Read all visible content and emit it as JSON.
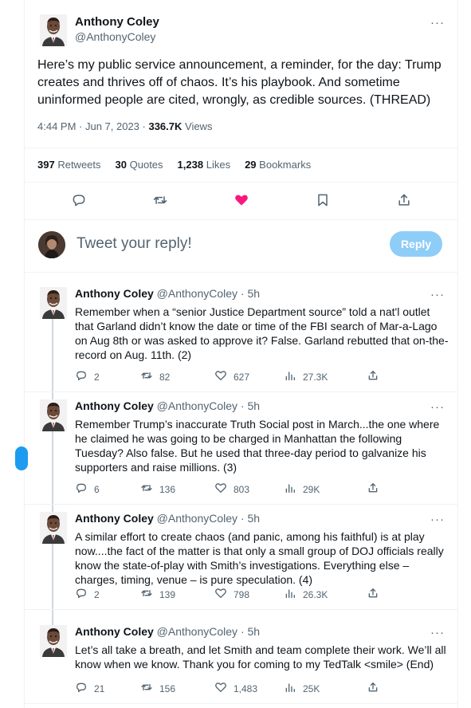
{
  "main_tweet": {
    "author_name": "Anthony Coley",
    "author_handle": "@AnthonyColey",
    "text": "Here’s my public service announcement, a reminder, for the day:  Trump creates and thrives off of chaos. It’s his playbook. And sometime uninformed people are cited, wrongly, as credible sources. (THREAD)",
    "time": "4:44 PM · Jun 7, 2023 · ",
    "views_count": "336.7K",
    "views_label": " Views",
    "stats": {
      "retweets_count": "397",
      "retweets_label": "Retweets",
      "quotes_count": "30",
      "quotes_label": "Quotes",
      "likes_count": "1,238",
      "likes_label": "Likes",
      "bookmarks_count": "29",
      "bookmarks_label": "Bookmarks"
    },
    "actions": [
      "reply",
      "retweet",
      "like",
      "bookmark",
      "share"
    ],
    "liked": true
  },
  "reply_box": {
    "placeholder": "Tweet your reply!",
    "button_label": "Reply"
  },
  "more_glyph": "···",
  "replies": [
    {
      "name": "Anthony Coley",
      "handle": "@AnthonyColey · 5h",
      "text": "Remember when a “senior Justice Department source” told a nat'l outlet that Garland didn’t know the date or time of the FBI search of Mar-a-Lago on Aug 8th or was asked to approve it? False. Garland rebutted that on-the-record on Aug. 11th. (2)",
      "replies": "2",
      "retweets": "82",
      "likes": "627",
      "views": "27.3K"
    },
    {
      "name": "Anthony Coley",
      "handle": "@AnthonyColey · 5h",
      "text": "Remember Trump’s inaccurate Truth Social post in March...the one where he claimed he was going to be charged in Manhattan the following Tuesday? Also false. But he used that three-day period to galvanize his supporters and raise millions. (3)",
      "replies": "6",
      "retweets": "136",
      "likes": "803",
      "views": "29K"
    },
    {
      "name": "Anthony Coley",
      "handle": "@AnthonyColey · 5h",
      "text": "A similar effort to create chaos (and panic, among his faithful) is at play now....the fact of the matter is that only a small group of DOJ officials really know the state-of-play with Smith’s investigations. Everything else – charges, timing, venue – is pure speculation. (4)",
      "replies": "2",
      "retweets": "139",
      "likes": "798",
      "views": "26.3K"
    },
    {
      "name": "Anthony Coley",
      "handle": "@AnthonyColey · 5h",
      "text": "Let’s all take a breath, and let Smith and team complete their work. We’ll all know when we know. Thank you for coming to my TedTalk <smile>  (End)",
      "replies": "21",
      "retweets": "156",
      "likes": "1,483",
      "views": "25K"
    }
  ],
  "colors": {
    "accent": "#1d9bf0",
    "like_active": "#f91880",
    "text_secondary": "#536471",
    "reply_button_disabled": "#8ecdf8"
  }
}
